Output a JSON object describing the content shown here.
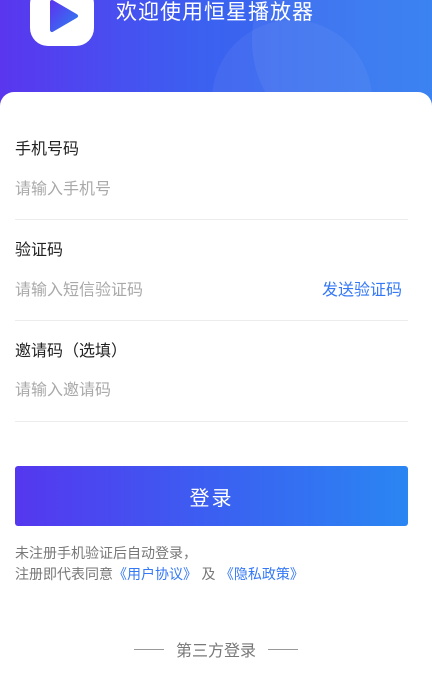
{
  "header": {
    "welcome_text": "欢迎使用恒星播放器"
  },
  "form": {
    "phone": {
      "label": "手机号码",
      "placeholder": "请输入手机号"
    },
    "code": {
      "label": "验证码",
      "placeholder": "请输入短信验证码",
      "send_label": "发送验证码"
    },
    "invite": {
      "label": "邀请码（选填）",
      "placeholder": "请输入邀请码"
    }
  },
  "login": {
    "label": "登录"
  },
  "agreement": {
    "line1": "未注册手机验证后自动登录，",
    "line2_prefix": "注册即代表同意",
    "user_agreement": "《用户协议》",
    "and": "及",
    "privacy_policy": "《隐私政策》"
  },
  "third_party": {
    "label": "第三方登录"
  },
  "colors": {
    "accent": "#3478f6",
    "header_start": "#5a36ef",
    "header_end": "#2f7cf1"
  }
}
